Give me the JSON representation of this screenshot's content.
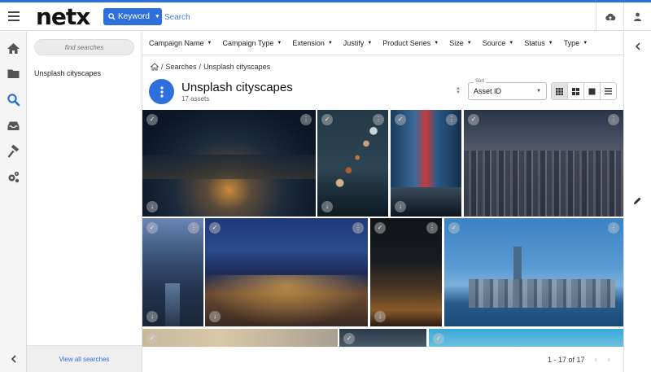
{
  "app": {
    "logo": "netx"
  },
  "topbar": {
    "keyword_label": "Keyword",
    "search_placeholder": "Search"
  },
  "sidebar": {
    "find_placeholder": "find searches",
    "items": [
      {
        "label": "Unsplash cityscapes"
      }
    ],
    "view_all": "View all searches"
  },
  "filters": [
    "Campaign Name",
    "Campaign Type",
    "Extension",
    "Justify",
    "Product Series",
    "Size",
    "Source",
    "Status",
    "Type"
  ],
  "breadcrumb": {
    "home_icon": "home-icon",
    "separator": "/",
    "searches": "Searches",
    "current": "Unsplash cityscapes"
  },
  "page": {
    "title": "Unsplash cityscapes",
    "subtitle": "17 assets"
  },
  "sort": {
    "label": "Sort",
    "value": "Asset ID"
  },
  "pagination": {
    "range": "1 - 17 of 17"
  },
  "colors": {
    "accent": "#2d6fdc"
  }
}
